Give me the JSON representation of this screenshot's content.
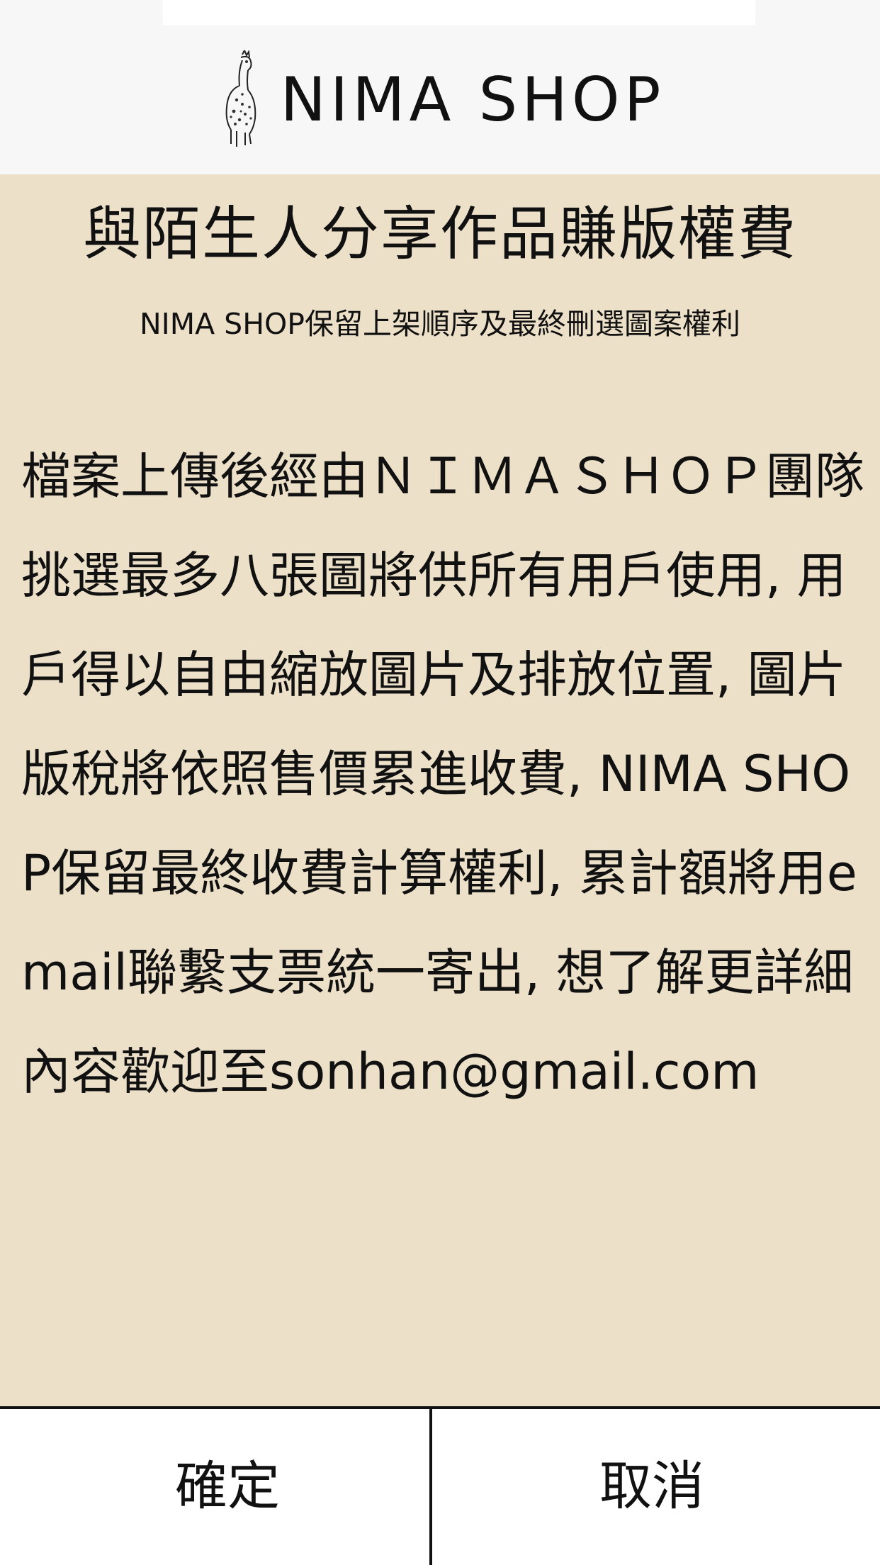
{
  "header": {
    "logo_icon": "alpaca-icon",
    "brand_name": "NIMA SHOP"
  },
  "content": {
    "title": "與陌生人分享作品賺版權費",
    "subtitle": "NIMA SHOP保留上架順序及最終刪選圖案權利",
    "body": "檔案上傳後經由ＮＩＭＡＳＨＯＰ團隊挑選最多八張圖將供所有用戶使用, 用戶得以自由縮放圖片及排放位置, 圖片版稅將依照售價累進收費, NIMA SHOP保留最終收費計算權利, 累計額將用email聯繫支票統一寄出, 想了解更詳細內容歡迎至sonhan@gmail.com",
    "background_color": "#ede0c9"
  },
  "footer": {
    "confirm_label": "確定",
    "cancel_label": "取消"
  }
}
